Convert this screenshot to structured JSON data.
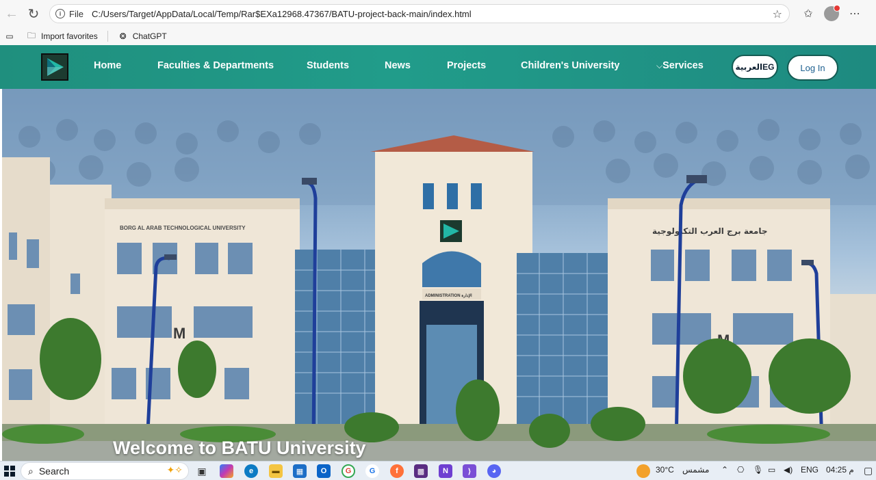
{
  "browser": {
    "url_scheme_label": "File",
    "url": "C:/Users/Target/AppData/Local/Temp/Rar$EXa12968.47367/BATU-project-back-main/index.html",
    "favorites": [
      {
        "label": "Import favorites",
        "icon": "folder-import-icon"
      },
      {
        "label": "ChatGPT",
        "icon": "chatgpt-icon"
      }
    ]
  },
  "site": {
    "nav": {
      "links": [
        "Home",
        "Faculties & Departments",
        "Students",
        "News",
        "Projects",
        "Children's University",
        "Services"
      ],
      "services_chevron": "⌵",
      "lang_button": "العربيةEG",
      "login_button": "Log In"
    },
    "hero": {
      "welcome_text": "Welcome to BATU University",
      "sign_english": "BORG AL ARAB TECHNOLOGICAL UNIVERSITY",
      "sign_arabic": "جامعة برج العرب التكنولوجية",
      "admin_sign": "ADMINISTRATION الإدارة"
    }
  },
  "taskbar": {
    "search_label": "Search",
    "weather_temp": "30°C",
    "weather_text": "مشمس",
    "language": "ENG",
    "time": "04:25 م"
  },
  "colors": {
    "navbar": "#219c8a",
    "login_text": "#1c5f8f"
  }
}
